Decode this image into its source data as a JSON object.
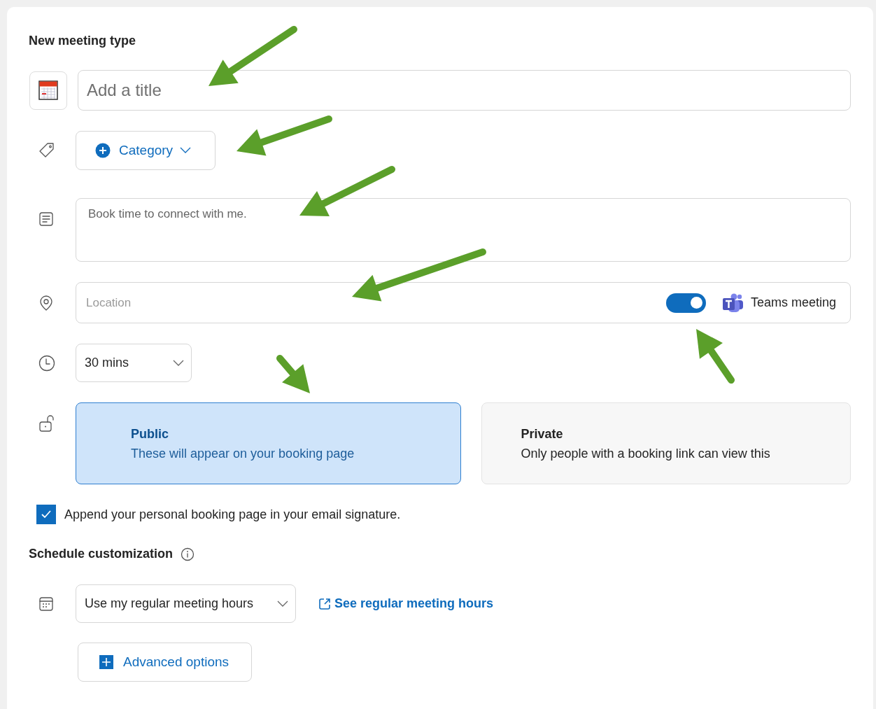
{
  "heading": "New meeting type",
  "title_field": {
    "placeholder": "Add a title"
  },
  "category_button": {
    "label": "Category"
  },
  "description_field": {
    "placeholder": "Book time to connect with me."
  },
  "location": {
    "placeholder": "Location",
    "teams_toggle": {
      "on": true
    },
    "teams_label": "Teams meeting"
  },
  "duration": {
    "value": "30 mins"
  },
  "visibility_options": [
    {
      "title": "Public",
      "description": "These will appear on your booking page",
      "selected": true
    },
    {
      "title": "Private",
      "description": "Only people with a booking link can view this",
      "selected": false
    }
  ],
  "append_signature": {
    "label": "Append your personal booking page in your email signature.",
    "checked": true
  },
  "schedule_customization": {
    "heading": "Schedule customization",
    "hours": {
      "value": "Use my regular meeting hours"
    },
    "see_hours_link": "See regular meeting hours",
    "advanced_button": "Advanced options"
  }
}
